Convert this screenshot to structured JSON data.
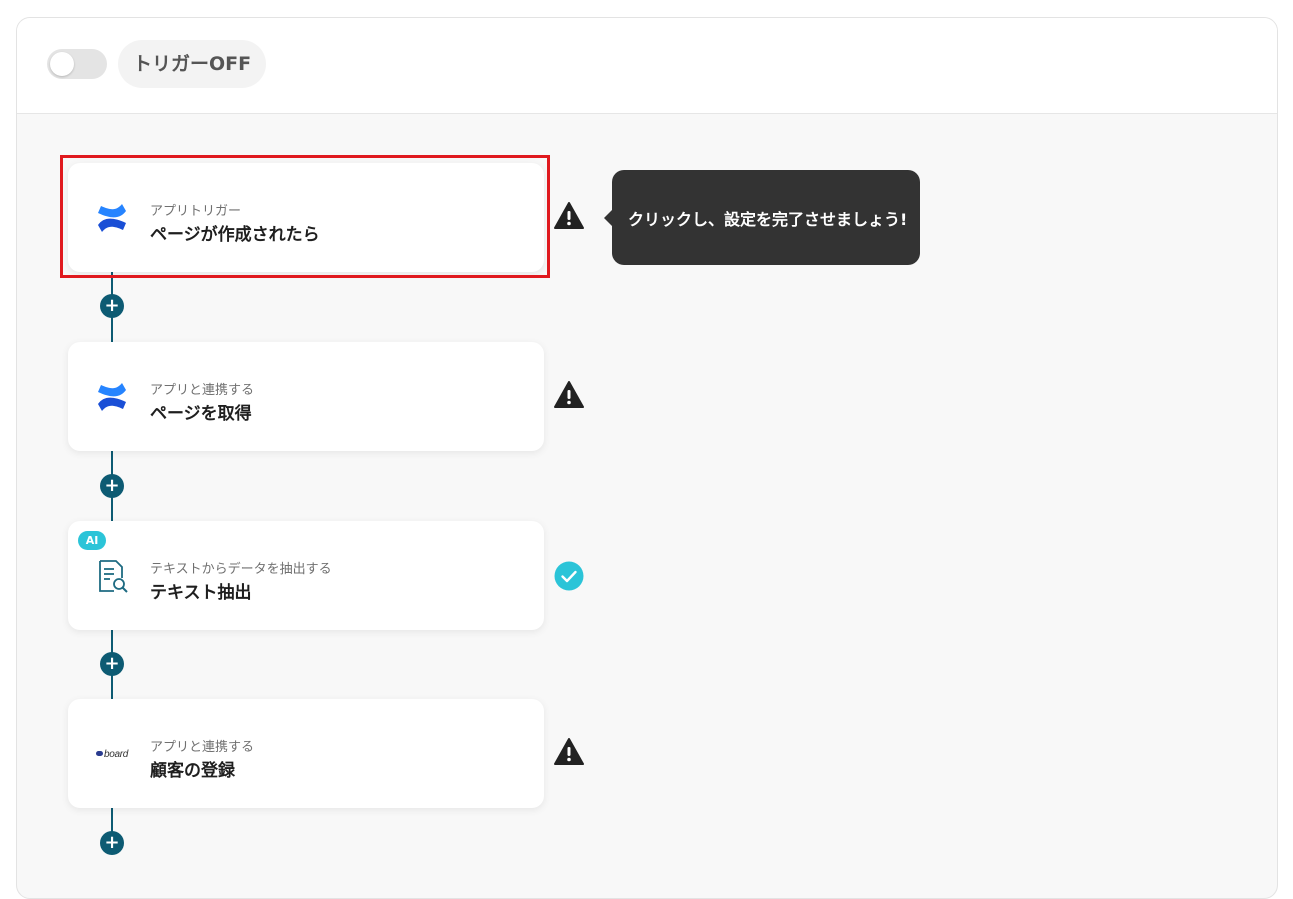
{
  "header": {
    "trigger_state_label": "トリガーOFF"
  },
  "flow": {
    "steps": [
      {
        "app_icon": "confluence-icon",
        "subtitle": "アプリトリガー",
        "title": "ページが作成されたら",
        "status": "warning",
        "ai_badge": ""
      },
      {
        "app_icon": "confluence-icon",
        "subtitle": "アプリと連携する",
        "title": "ページを取得",
        "status": "warning",
        "ai_badge": ""
      },
      {
        "app_icon": "document-search-icon",
        "subtitle": "テキストからデータを抽出する",
        "title": "テキスト抽出",
        "status": "complete",
        "ai_badge": "AI"
      },
      {
        "app_icon": "board-logo",
        "subtitle": "アプリと連携する",
        "title": "顧客の登録",
        "status": "warning",
        "ai_badge": "",
        "logo_text": "board"
      }
    ],
    "add_step_symbol": "+"
  },
  "tooltip": {
    "text": "クリックし、設定を完了させましょう!"
  },
  "colors": {
    "connector": "#0d5b73",
    "highlight": "#e0191e",
    "ai_badge": "#2bc4d8",
    "complete": "#2bc4d8",
    "confluence_dark": "#1a4fd6",
    "confluence_light": "#2684ff"
  }
}
